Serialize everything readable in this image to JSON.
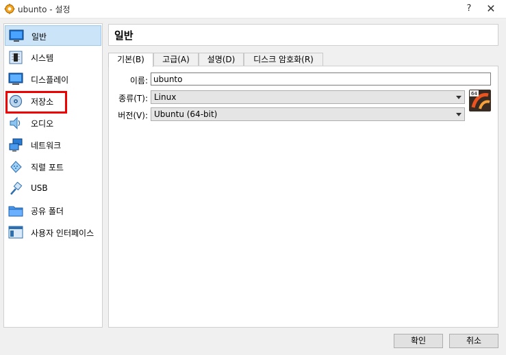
{
  "window": {
    "title": "ubunto - 설정",
    "help_label": "?",
    "close_label": "✕"
  },
  "sidebar": {
    "items": [
      {
        "label": "일반",
        "icon": "general-monitor-icon",
        "selected": true
      },
      {
        "label": "시스템",
        "icon": "chip-icon",
        "selected": false
      },
      {
        "label": "디스플레이",
        "icon": "display-icon",
        "selected": false
      },
      {
        "label": "저장소",
        "icon": "disk-icon",
        "selected": false
      },
      {
        "label": "오디오",
        "icon": "speaker-icon",
        "selected": false
      },
      {
        "label": "네트워크",
        "icon": "network-icon",
        "selected": false
      },
      {
        "label": "직렬 포트",
        "icon": "serial-port-icon",
        "selected": false
      },
      {
        "label": "USB",
        "icon": "usb-icon",
        "selected": false
      },
      {
        "label": "공유 폴더",
        "icon": "folder-icon",
        "selected": false
      },
      {
        "label": "사용자 인터페이스",
        "icon": "ui-window-icon",
        "selected": false
      }
    ],
    "highlighted_item": "저장소"
  },
  "main": {
    "section_title": "일반",
    "tabs": [
      {
        "label": "기본(B)",
        "active": true
      },
      {
        "label": "고급(A)",
        "active": false
      },
      {
        "label": "설명(D)",
        "active": false
      },
      {
        "label": "디스크 암호화(R)",
        "active": false
      }
    ],
    "form": {
      "name_label": "이름:",
      "name_value": "ubunto",
      "type_label": "종류(T):",
      "type_value": "Linux",
      "version_label": "버전(V):",
      "version_value": "Ubuntu (64-bit)",
      "os_badge": "64"
    }
  },
  "footer": {
    "ok_label": "확인",
    "cancel_label": "취소"
  },
  "colors": {
    "selected_bg": "#cce4f7",
    "highlight_border": "#ee0000",
    "ubuntu_orange": "#e95420"
  }
}
